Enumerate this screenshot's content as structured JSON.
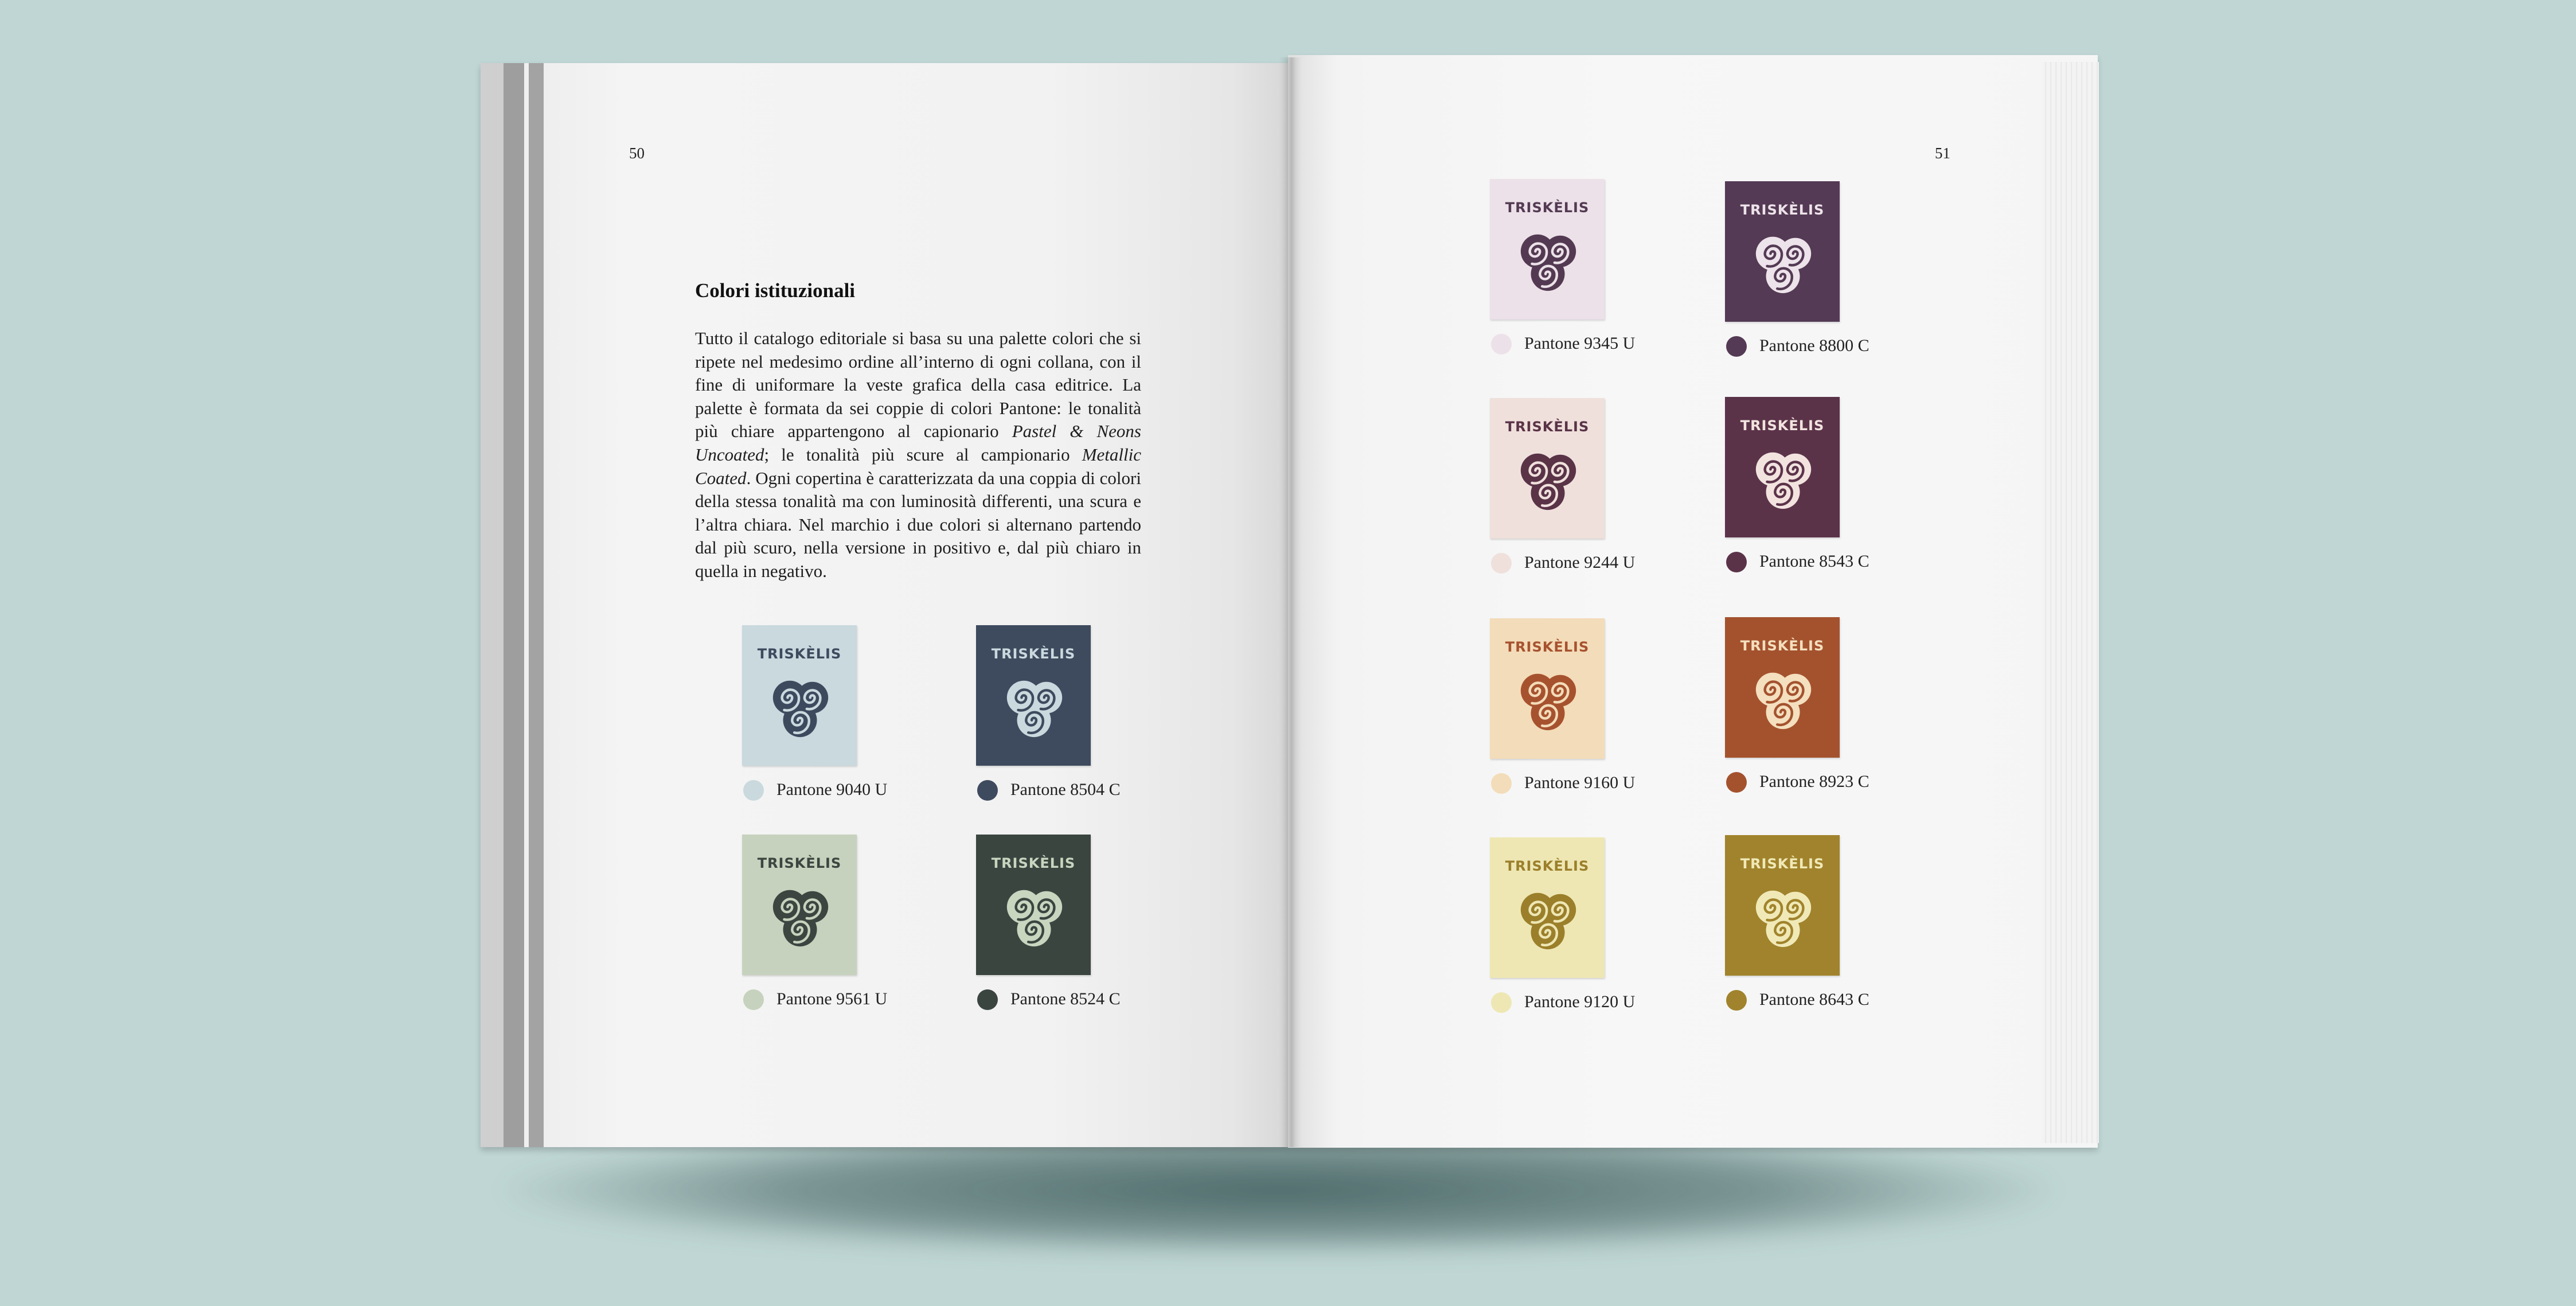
{
  "left_page": {
    "number": "50",
    "heading": "Colori istituzionali",
    "paragraph": [
      {
        "t": "Tutto il catalogo editoriale si basa su una palette colori che si ripete nel medesimo ordine all’interno di ogni collana, con il fine di uniformare la veste grafica della casa editri­ce. La palette è formata da sei coppie di colori Pantone: le tonalità più chiare appartengono al capionario ",
        "i": false
      },
      {
        "t": "Pastel & Neons Uncoated",
        "i": true
      },
      {
        "t": "; le tonalità più scure al campionario ",
        "i": false
      },
      {
        "t": "Metallic Coated",
        "i": true
      },
      {
        "t": ". Ogni copertina è caratterizzata da una coppia di colori della stessa tonalità ma con luminosità differenti, una scura e l’altra chiara. Nel marchio i due colori si alternano partendo dal più scuro, nella versione in positivo e, dal più chiaro in quella in negativo.",
        "i": false
      }
    ]
  },
  "right_page": {
    "number": "51"
  },
  "brand_name": "TRISKÈLIS",
  "swatches": [
    {
      "label": "Pantone 9040 U",
      "bg": "#c9d9de",
      "fg": "#3d4a5e"
    },
    {
      "label": "Pantone 8504 C",
      "bg": "#3e4a5e",
      "fg": "#c9d9de"
    },
    {
      "label": "Pantone 9561 U",
      "bg": "#c6d2bd",
      "fg": "#3c4540"
    },
    {
      "label": "Pantone 8524 C",
      "bg": "#3b4540",
      "fg": "#c8d5bf"
    },
    {
      "label": "Pantone 9345 U",
      "bg": "#ece1e8",
      "fg": "#533a52"
    },
    {
      "label": "Pantone 8800 C",
      "bg": "#543a54",
      "fg": "#ede3ea"
    },
    {
      "label": "Pantone 9244 U",
      "bg": "#efe0dc",
      "fg": "#5a3347"
    },
    {
      "label": "Pantone 8543 C",
      "bg": "#5b3349",
      "fg": "#f2e3df"
    },
    {
      "label": "Pantone 9160 U",
      "bg": "#f3dcb9",
      "fg": "#a7522f"
    },
    {
      "label": "Pantone 8923 C",
      "bg": "#a4522e",
      "fg": "#f4dfbe"
    },
    {
      "label": "Pantone 9120 U",
      "bg": "#eee7b4",
      "fg": "#9b7f2a"
    },
    {
      "label": "Pantone 8643 C",
      "bg": "#a0832c",
      "fg": "#f0e9b7"
    }
  ]
}
